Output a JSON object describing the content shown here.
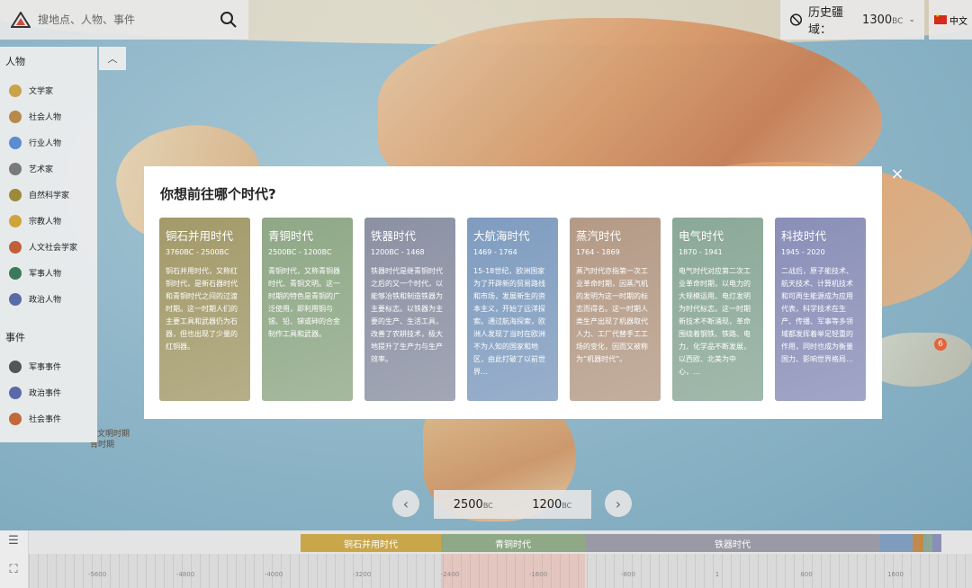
{
  "search": {
    "placeholder": "搜地点、人物、事件"
  },
  "era_select": {
    "label": "历史疆域：",
    "value": "1300",
    "unit": "BC"
  },
  "language": {
    "label": "中文"
  },
  "sidebar": {
    "people_title": "人物",
    "people": [
      {
        "label": "文学家",
        "color": "#c9a24a"
      },
      {
        "label": "社会人物",
        "color": "#b58a4a"
      },
      {
        "label": "行业人物",
        "color": "#5b8bd0"
      },
      {
        "label": "艺术家",
        "color": "#7a7a7a"
      },
      {
        "label": "自然科学家",
        "color": "#9a8a3a"
      },
      {
        "label": "宗教人物",
        "color": "#d0a43a"
      },
      {
        "label": "人文社会学家",
        "color": "#c0603a"
      },
      {
        "label": "军事人物",
        "color": "#3a7a5a"
      },
      {
        "label": "政治人物",
        "color": "#5a6aa8"
      }
    ],
    "events_title": "事件",
    "events": [
      {
        "label": "军事事件",
        "color": "#555555"
      },
      {
        "label": "政治事件",
        "color": "#5a6aa8"
      },
      {
        "label": "社会事件",
        "color": "#c06a3a"
      }
    ]
  },
  "map_labels": {
    "civ": "文明时期",
    "period": "青时期",
    "badge": "6"
  },
  "dialog": {
    "title": "你想前往哪个时代?",
    "close": "×",
    "eras": [
      {
        "name": "铜石并用时代",
        "range": "3760BC - 2500BC",
        "desc": "铜石并用时代，又称红铜时代，是新石器时代和青铜时代之间的过渡时期。这一时期人们的主要工具和武器仍为石器，但也出现了少量的红铜器。",
        "color": "#a39a6a"
      },
      {
        "name": "青铜时代",
        "range": "2500BC - 1200BC",
        "desc": "青铜时代，又称青铜器时代、青铜文明。这一时期的特色是青铜的广泛使用，即利用铜与锡、铅、锑或砷的合金制作工具和武器。",
        "color": "#8fa886"
      },
      {
        "name": "铁器时代",
        "range": "1200BC - 1468",
        "desc": "铁器时代是继青铜时代之后的又一个时代，以能够冶铁和制造铁器为主要标志。以铁器为主要的生产、生活工具，改善了农耕技术，极大地提升了生产力与生产效率。",
        "color": "#8b91a3"
      },
      {
        "name": "大航海时代",
        "range": "1469 - 1764",
        "desc": "15-18世纪，欧洲国家为了开辟新的贸易路线和市场，发展新生的资本主义，开始了远洋探索。通过航海探索，欧洲人发现了当时在欧洲不为人知的国家和地区，由此打破了以前世界…",
        "color": "#7f9cbf"
      },
      {
        "name": "蒸汽时代",
        "range": "1764 - 1869",
        "desc": "蒸汽时代亦指第一次工业革命时期，因蒸汽机的发明为这一时期的标志而得名。这一时期人类生产出现了机器取代人力、工厂代替手工工场的变化，因而又被称为“机器时代”。",
        "color": "#b49a86"
      },
      {
        "name": "电气时代",
        "range": "1870 - 1941",
        "desc": "电气时代对应第二次工业革命时期，以电力的大规模运用、电灯发明为时代标志。这一时期新技术不断涌现，革命围绕着钢铁、铁路、电力、化学品不断发展，以西欧、北美为中心，…",
        "color": "#8aa898"
      },
      {
        "name": "科技时代",
        "range": "1945 - 2020",
        "desc": "二战后，原子能技术、航天技术、计算机技术和可再生能源成为应用代表，科学技术在生产、传播、军事等多领域都发挥着举足轻重的作用，同时也成为衡量国力、影响世界格局…",
        "color": "#8a8fb8"
      }
    ]
  },
  "range_pill": {
    "start": "2500",
    "start_unit": "BC",
    "end": "1200",
    "end_unit": "BC"
  },
  "timeline": {
    "bands": [
      {
        "label": "铜石并用时代",
        "color": "#c9a64a"
      },
      {
        "label": "青铜时代",
        "color": "#8fa886"
      },
      {
        "label": "铁器时代",
        "color": "#9a9aa6"
      }
    ],
    "ticks": [
      "-5600",
      "-4800",
      "-4000",
      "-3200",
      "-2400",
      "-1600",
      "-800",
      "1",
      "800",
      "1600"
    ]
  }
}
